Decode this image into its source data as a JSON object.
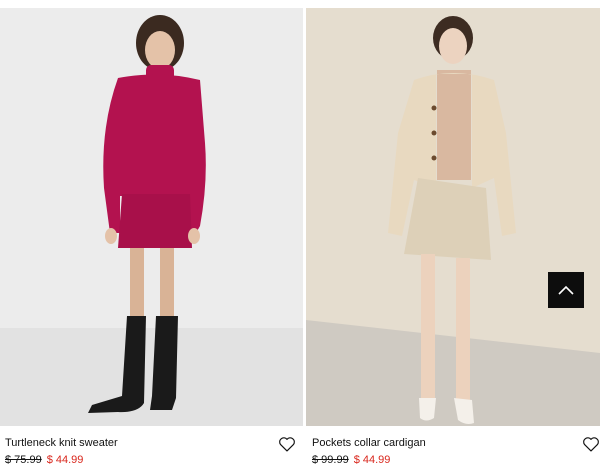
{
  "products": [
    {
      "name": "Turtleneck knit sweater",
      "old_price": "$ 75.99",
      "sale_price": "$ 44.99",
      "image_icon": "model-photo",
      "wishlist_icon": "heart-icon"
    },
    {
      "name": "Pockets collar cardigan",
      "old_price": "$ 99.99",
      "sale_price": "$ 44.99",
      "image_icon": "model-photo",
      "wishlist_icon": "heart-icon"
    }
  ],
  "scroll_top": {
    "icon": "chevron-up-icon"
  },
  "colors": {
    "sale": "#d9261c",
    "text": "#111111",
    "scroll_button_bg": "#0d0d0d"
  }
}
